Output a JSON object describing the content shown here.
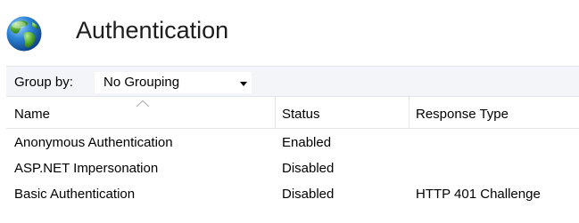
{
  "header": {
    "title": "Authentication",
    "icon": "globe-icon"
  },
  "toolbar": {
    "group_by_label": "Group by:",
    "group_by_value": "No Grouping"
  },
  "table": {
    "columns": [
      "Name",
      "Status",
      "Response Type"
    ],
    "sort_column": "Name",
    "rows": [
      {
        "name": "Anonymous Authentication",
        "status": "Enabled",
        "response_type": ""
      },
      {
        "name": "ASP.NET Impersonation",
        "status": "Disabled",
        "response_type": ""
      },
      {
        "name": "Basic Authentication",
        "status": "Disabled",
        "response_type": "HTTP 401 Challenge"
      }
    ]
  },
  "colors": {
    "toolbar_background": "#f4f5f9",
    "globe_blue": "#1f73c6",
    "globe_green": "#4ea72e"
  }
}
